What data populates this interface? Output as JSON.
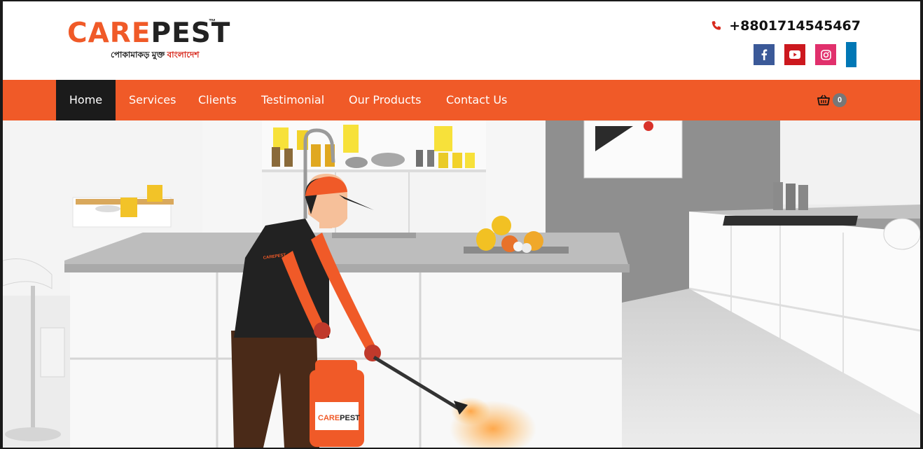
{
  "brand": {
    "care": "CARE",
    "pest": "PEST",
    "tm": "™",
    "tagline_part1": "পোকামাকড় মুক্ত ",
    "tagline_part2": "বাংলাদেশ"
  },
  "contact": {
    "phone": "+8801714545467"
  },
  "social": [
    {
      "name": "facebook",
      "icon": "facebook-icon",
      "color": "#3b5998"
    },
    {
      "name": "youtube",
      "icon": "youtube-icon",
      "color": "#cc181e"
    },
    {
      "name": "instagram",
      "icon": "instagram-icon",
      "color": "#e1306c"
    },
    {
      "name": "linkedin",
      "icon": "linkedin-icon",
      "color": "#0077b5"
    }
  ],
  "nav": {
    "items": [
      {
        "label": "Home",
        "active": true
      },
      {
        "label": "Services"
      },
      {
        "label": "Clients"
      },
      {
        "label": "Testimonial"
      },
      {
        "label": "Our Products"
      },
      {
        "label": "Contact Us"
      }
    ],
    "cart_count": "0"
  },
  "hero": {
    "tank_label_care": "CARE",
    "tank_label_pest": "PEST",
    "vest_label": "CAREPEST"
  },
  "colors": {
    "accent": "#f05a28",
    "nav_active": "#1b1b1b"
  }
}
